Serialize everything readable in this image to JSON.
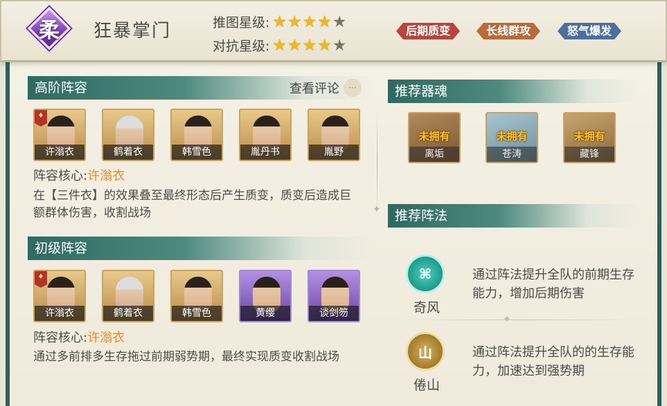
{
  "header": {
    "emblem_char": "柔",
    "title": "狂暴掌门",
    "rating_push_label": "推图星级:",
    "rating_push": 4,
    "rating_pvp_label": "对抗星级:",
    "rating_pvp": 4,
    "rating_max": 5,
    "tags": [
      "后期质变",
      "长线群攻",
      "怒气爆发"
    ],
    "tag_colors": [
      "#b8453c",
      "#b86a3a",
      "#4c6f9c"
    ]
  },
  "advanced": {
    "title": "高阶阵容",
    "review_label": "查看评论",
    "heroes": [
      "许滃衣",
      "鹤着衣",
      "韩雪色",
      "胤丹书",
      "胤野"
    ],
    "core_label": "阵容核心:",
    "core_name": "许滃衣",
    "description": "在【三件衣】的效果叠至最终形态后产生质变，质变后造成巨额群体伤害，收割战场"
  },
  "basic": {
    "title": "初级阵容",
    "heroes": [
      "许滃衣",
      "鹤着衣",
      "韩雪色",
      "黄缨",
      "谈剑笏"
    ],
    "core_label": "阵容核心:",
    "core_name": "许滃衣",
    "description": "通过多前排多生存拖过前期弱势期，最终实现质变收割战场"
  },
  "souls": {
    "title": "推荐器魂",
    "unowned_label": "未拥有",
    "items": [
      "离垢",
      "苍涛",
      "藏锋"
    ]
  },
  "formations": {
    "title": "推荐阵法",
    "items": [
      {
        "name": "奇风",
        "description": "通过阵法提升全队的前期生存能力，增加后期伤害"
      },
      {
        "name": "倦山",
        "description": "通过阵法提升全队的的生存能力，加速达到强势期"
      }
    ]
  }
}
